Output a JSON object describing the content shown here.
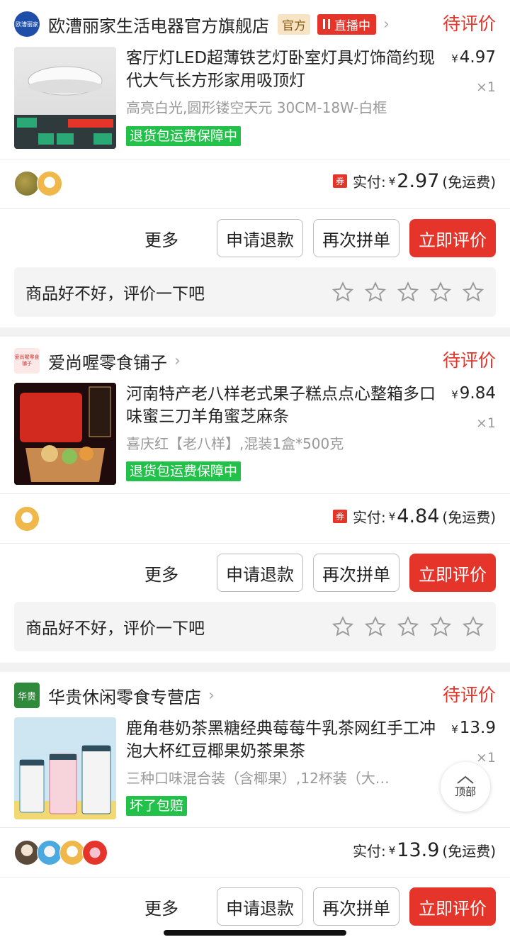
{
  "orders": [
    {
      "shop_name": "欧漕丽家生活电器官方旗舰店",
      "tag_official": "官方",
      "tag_live": "直播中",
      "status": "待评价",
      "logo_text": "欧漕丽家",
      "product_title": "客厅灯LED超薄铁艺灯卧室灯具灯饰简约现代大气长方形家用吸顶灯",
      "spec": "高亮白光,圆形镂空天元 30CM-18W-白框",
      "guarantee": "退货包运费保障中",
      "price": "4.97",
      "qty": "×1",
      "coupon": "券",
      "paid_label": "实付:",
      "paid_amount": "2.97",
      "shipping": "(免运费)",
      "more": "更多",
      "refund": "申请退款",
      "rebuy": "再次拼单",
      "review": "立即评价",
      "review_prompt": "商品好不好，评价一下吧"
    },
    {
      "shop_name": "爱尚喔零食铺子",
      "status": "待评价",
      "logo_text": "爱尚喔零食铺子",
      "product_title": "河南特产老八样老式果子糕点点心整箱多口味蜜三刀羊角蜜芝麻条",
      "spec": "喜庆红【老八样】,混装1盒*500克",
      "guarantee": "退货包运费保障中",
      "price": "9.84",
      "qty": "×1",
      "coupon": "券",
      "paid_label": "实付:",
      "paid_amount": "4.84",
      "shipping": "(免运费)",
      "more": "更多",
      "refund": "申请退款",
      "rebuy": "再次拼单",
      "review": "立即评价",
      "review_prompt": "商品好不好，评价一下吧"
    },
    {
      "shop_name": "华贵休闲零食专营店",
      "status": "待评价",
      "logo_text": "华贵",
      "product_title": "鹿角巷奶茶黑糖经典莓莓牛乳茶网红手工冲泡大杯红豆椰果奶茶果茶",
      "spec": "三种口味混合装（含椰果）,12杯装（大…",
      "guarantee": "坏了包赔",
      "price": "13.9",
      "qty": "×1",
      "paid_label": "实付:",
      "paid_amount": "13.9",
      "shipping": "(免运费)",
      "more": "更多",
      "refund": "申请退款",
      "rebuy": "再次拼单",
      "review": "立即评价"
    }
  ],
  "currency": "¥",
  "back_to_top": "顶部",
  "colors": {
    "accent": "#e5352b",
    "green": "#22c14a"
  }
}
